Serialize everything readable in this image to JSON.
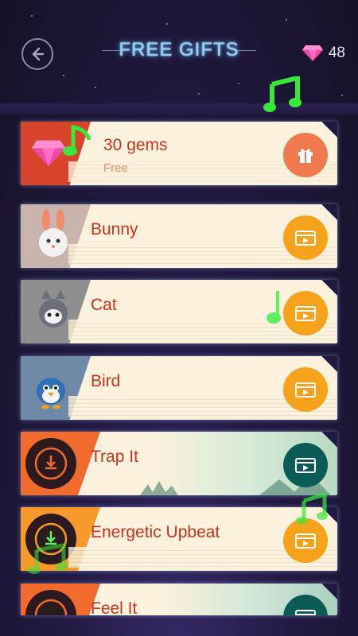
{
  "header": {
    "title": "FREE GIFTS",
    "gem_count": "48"
  },
  "items": [
    {
      "label": "30 gems",
      "sub": "Free",
      "action": "gift-icon"
    },
    {
      "label": "Bunny",
      "action": "video-icon"
    },
    {
      "label": "Cat",
      "action": "video-icon"
    },
    {
      "label": "Bird",
      "action": "video-icon"
    },
    {
      "label": "Trap It",
      "action": "video-icon"
    },
    {
      "label": "Energetic Upbeat",
      "action": "video-icon"
    },
    {
      "label": "Feel It",
      "action": "video-icon"
    }
  ],
  "colors": {
    "title_glow": "#8fd4ff",
    "label_red": "#c8341e",
    "action_orange": "#f7a21b",
    "action_coral": "#f07a4e",
    "action_teal": "#0b5b57",
    "note_green": "#38e83a"
  }
}
